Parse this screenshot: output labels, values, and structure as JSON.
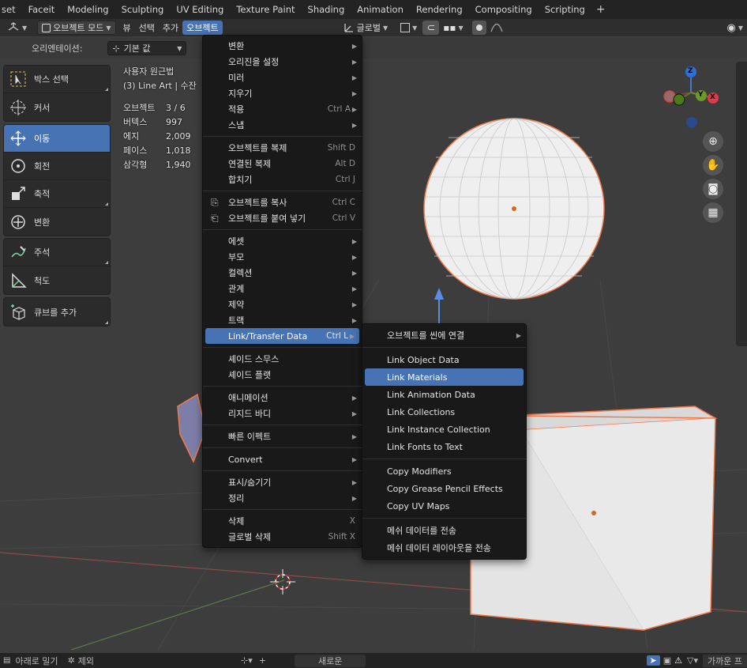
{
  "workspaces": [
    "set",
    "Faceit",
    "Modeling",
    "Sculpting",
    "UV Editing",
    "Texture Paint",
    "Shading",
    "Animation",
    "Rendering",
    "Compositing",
    "Scripting"
  ],
  "header": {
    "mode": "오브젝트 모드",
    "menus": [
      "뷰",
      "선택",
      "추가",
      "오브젝트"
    ],
    "transform_orientation": "글로벌"
  },
  "tool_header": {
    "orientation_label": "오리엔테이션:",
    "orientation_value": "기본 값"
  },
  "overlay": {
    "view_name": "사용자 원근법",
    "collection": "(3) Line Art | 수잔",
    "stats": [
      {
        "k": "오브젝트",
        "v": "3 / 6"
      },
      {
        "k": "버텍스",
        "v": "997"
      },
      {
        "k": "에지",
        "v": "2,009"
      },
      {
        "k": "페이스",
        "v": "1,018"
      },
      {
        "k": "삼각형",
        "v": "1,940"
      }
    ]
  },
  "tools": {
    "select_box": "박스 선택",
    "cursor": "커서",
    "move": "이동",
    "rotate": "회전",
    "scale": "축적",
    "transform": "변환",
    "annotate": "주석",
    "measure": "척도",
    "add_cube": "큐브를 추가"
  },
  "object_menu": [
    {
      "label": "변환",
      "arrow": true
    },
    {
      "label": "오리진을 설정",
      "arrow": true
    },
    {
      "label": "미러",
      "arrow": true
    },
    {
      "label": "지우기",
      "arrow": true
    },
    {
      "label": "적용",
      "shortcut": "Ctrl A",
      "arrow": true
    },
    {
      "label": "스냅",
      "arrow": true
    },
    {
      "sep": true
    },
    {
      "label": "오브젝트를 복제",
      "shortcut": "Shift D"
    },
    {
      "label": "연결된 복제",
      "shortcut": "Alt D"
    },
    {
      "label": "합치기",
      "shortcut": "Ctrl J"
    },
    {
      "sep": true
    },
    {
      "label": "오브젝트를 복사",
      "shortcut": "Ctrl C",
      "icon": "copy"
    },
    {
      "label": "오브젝트를 붙여 넣기",
      "shortcut": "Ctrl V",
      "icon": "paste"
    },
    {
      "sep": true
    },
    {
      "label": "에셋",
      "arrow": true
    },
    {
      "label": "부모",
      "arrow": true
    },
    {
      "label": "컬렉션",
      "arrow": true
    },
    {
      "label": "관계",
      "arrow": true
    },
    {
      "label": "제약",
      "arrow": true
    },
    {
      "label": "트랙",
      "arrow": true
    },
    {
      "label": "Link/Transfer Data",
      "shortcut": "Ctrl L",
      "arrow": true,
      "highlight": true
    },
    {
      "sep": true
    },
    {
      "label": "셰이드 스무스"
    },
    {
      "label": "셰이드 플랫"
    },
    {
      "sep": true
    },
    {
      "label": "애니메이션",
      "arrow": true
    },
    {
      "label": "리지드 바디",
      "arrow": true
    },
    {
      "sep": true
    },
    {
      "label": "빠른 이펙트",
      "arrow": true
    },
    {
      "sep": true
    },
    {
      "label": "Convert",
      "arrow": true
    },
    {
      "sep": true
    },
    {
      "label": "표시/숨기기",
      "arrow": true
    },
    {
      "label": "정리",
      "arrow": true
    },
    {
      "sep": true
    },
    {
      "label": "삭제",
      "shortcut": "X"
    },
    {
      "label": "글로벌 삭제",
      "shortcut": "Shift X"
    }
  ],
  "link_submenu": [
    {
      "label": "오브젝트를 씬에 연결",
      "arrow": true
    },
    {
      "sep": true
    },
    {
      "label": "Link Object Data"
    },
    {
      "label": "Link Materials",
      "highlight": true
    },
    {
      "label": "Link Animation Data"
    },
    {
      "label": "Link Collections"
    },
    {
      "label": "Link Instance Collection"
    },
    {
      "label": "Link Fonts to Text"
    },
    {
      "sep": true
    },
    {
      "label": "Copy Modifiers"
    },
    {
      "label": "Copy Grease Pencil Effects"
    },
    {
      "label": "Copy UV Maps"
    },
    {
      "sep": true
    },
    {
      "label": "메쉬 데이터를 전송"
    },
    {
      "label": "메쉬 데이터 레이아웃을 전송"
    }
  ],
  "gizmo": {
    "z": "Z",
    "y": "Y",
    "x": "X"
  },
  "statusbar": {
    "push_back": "아래로 밀기",
    "exclude": "제외",
    "new": "새로운",
    "nearest": "가까운 프"
  },
  "colors": {
    "accent": "#4772b3",
    "selection_outline": "#f07a4a"
  }
}
